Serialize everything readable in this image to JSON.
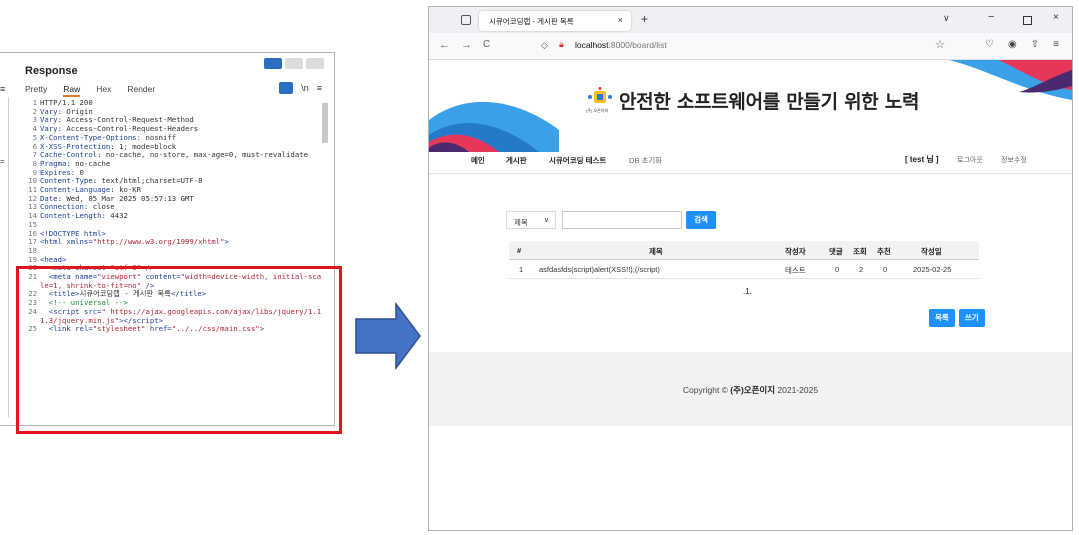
{
  "burp": {
    "title": "Response",
    "tabs": [
      "Pretty",
      "Raw",
      "Hex",
      "Render"
    ],
    "active_tab": "Raw",
    "tool_newline": "\\n",
    "tool_menu": "≡",
    "left_edge_1": "≡",
    "left_edge_2": "=",
    "lines": [
      {
        "n": "1",
        "html": "HTTP/1.1 200"
      },
      {
        "n": "2",
        "html": "<span class=\"k\">Vary</span>: Origin"
      },
      {
        "n": "3",
        "html": "<span class=\"k\">Vary</span>: Access-Control-Request-Method"
      },
      {
        "n": "4",
        "html": "<span class=\"k\">Vary</span>: Access-Control-Request-Headers"
      },
      {
        "n": "5",
        "html": "<span class=\"k\">X-Content-Type-Options</span>: nosniff"
      },
      {
        "n": "6",
        "html": "<span class=\"k\">X-XSS-Protection</span>: 1; mode=block"
      },
      {
        "n": "7",
        "html": "<span class=\"k\">Cache-Control</span>: no-cache, no-store, max-age=0, must-revalidate"
      },
      {
        "n": "8",
        "html": "<span class=\"k\">Pragma</span>: no-cache"
      },
      {
        "n": "9",
        "html": "<span class=\"k\">Expires</span>: 0"
      },
      {
        "n": "10",
        "html": "<span class=\"k\">Content-Type</span>: text/html;charset=UTF-8"
      },
      {
        "n": "11",
        "html": "<span class=\"k\">Content-Language</span>: ko-KR"
      },
      {
        "n": "12",
        "html": "<span class=\"k\">Date</span>: Wed, 05 Mar 2025 05:57:13 GMT"
      },
      {
        "n": "13",
        "html": "<span class=\"k\">Connection</span>: close"
      },
      {
        "n": "14",
        "html": "<span class=\"k\">Content-Length</span>: 4432"
      },
      {
        "n": "15",
        "html": ""
      },
      {
        "n": "16",
        "html": "<span class=\"k\">&lt;!DOCTYPE html&gt;</span>"
      },
      {
        "n": "17",
        "html": "<span class=\"k\">&lt;html xmlns=</span><span class=\"s\">\"http://www.w3.org/1999/xhtml\"</span><span class=\"k\">&gt;</span>"
      },
      {
        "n": "18",
        "html": ""
      },
      {
        "n": "19",
        "html": "<span class=\"k\">&lt;head&gt;</span>"
      },
      {
        "n": "20",
        "html": "  <span class=\"k\">&lt;meta charset=</span><span class=\"s\">\"utf-8\"</span> <span class=\"k\">/&gt;</span>"
      },
      {
        "n": "21",
        "html": "  <span class=\"k\">&lt;meta name=</span><span class=\"s\">\"viewport\"</span> <span class=\"k\">content=</span><span class=\"s\">\"width=device-width, initial-scale=1, shrink-to-fit=no\"</span> <span class=\"k\">/&gt;</span>"
      },
      {
        "n": "22",
        "html": "  <span class=\"k\">&lt;title&gt;</span>시큐어코딩랩 - 게시판 목록<span class=\"k\">&lt;/title&gt;</span>"
      },
      {
        "n": "23",
        "html": "  <span class=\"c\">&lt;!-- universal --&gt;</span>"
      },
      {
        "n": "24",
        "html": "  <span class=\"k\">&lt;script src=</span><span class=\"s\">\" https://ajax.googleapis.com/ajax/libs/jquery/1.11.3/jquery.min.js\"</span><span class=\"k\">&gt;&lt;/script&gt;</span>"
      },
      {
        "n": "25",
        "html": "  <span class=\"k\">&lt;link rel=</span><span class=\"s\">\"stylesheet\"</span> <span class=\"k\">href=</span><span class=\"s\">\"../../css/main.css\"</span><span class=\"k\">&gt;</span>"
      }
    ]
  },
  "browser": {
    "tab_title": "시큐어코딩랩 - 게시판 목록",
    "tab_close": "×",
    "new_tab": "+",
    "chevron": "∨",
    "win_min": "−",
    "win_close": "×",
    "back": "←",
    "forward": "→",
    "reload": "C",
    "url_host": "localhost",
    "url_rest": ":8000/board/list",
    "star": "☆",
    "right_icons": [
      "♡",
      "◉",
      "⇧",
      "≡"
    ]
  },
  "page": {
    "hero_title": "안전한 소프트웨어를 만들기 위한 노력",
    "logo_caption": "(주) 오픈이지",
    "menu": [
      "메인",
      "게시판",
      "시큐어코딩 테스트",
      "DB 초기화"
    ],
    "user_badge": "[ test 님 ]",
    "menu_right": [
      "로그아웃",
      "정보수정"
    ],
    "search_select": "제목",
    "search_button": "검색",
    "columns": [
      "#",
      "제목",
      "작성자",
      "댓글",
      "조회",
      "추천",
      "작성일"
    ],
    "rows": [
      {
        "no": "1",
        "title": "asfdasfds(script)alert(XSS!!);(/script)",
        "author": "테스트",
        "comments": "0",
        "views": "2",
        "likes": "0",
        "date": "2025-02-25"
      }
    ],
    "pager": ".1.",
    "btn_list": "목록",
    "btn_write": "쓰기",
    "footer_prefix": "Copyright © ",
    "footer_company": "(주)오픈이지",
    "footer_years": " 2021-2025"
  },
  "colors": {
    "highlight_border": "#e0161e",
    "arrow_fill": "#4472c4",
    "button_blue": "#1e90ff"
  }
}
